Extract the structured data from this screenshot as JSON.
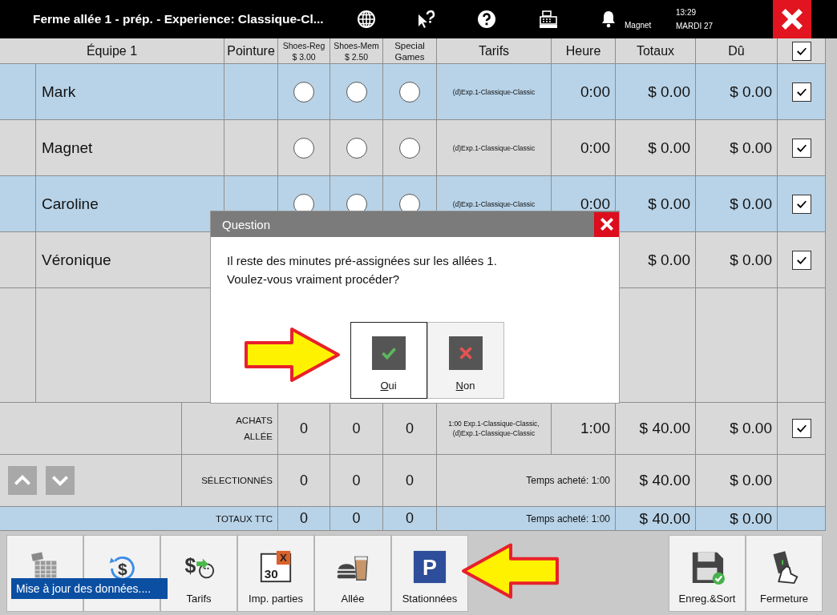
{
  "title_bar": {
    "title": "Ferme allée 1 - prép. - Experience: Classique-Cl...",
    "user": "Magnet",
    "time": "13:29",
    "date": "MARDI 27"
  },
  "table": {
    "columns": [
      {
        "label": "Équipe 1"
      },
      {
        "label": "Pointure"
      },
      {
        "label": "Shoes-Reg",
        "sub": "$ 3.00"
      },
      {
        "label": "Shoes-Mem",
        "sub": "$ 2.50"
      },
      {
        "label": "Special Games"
      },
      {
        "label": "Tarifs"
      },
      {
        "label": "Heure"
      },
      {
        "label": "Totaux"
      },
      {
        "label": "Dû"
      }
    ],
    "header_checked": true,
    "rows": [
      {
        "name": "Mark",
        "highlighted": true,
        "radios": [
          {
            "checked": false
          },
          {
            "checked": false
          },
          {
            "checked": false
          }
        ],
        "tarif": "(d)Exp.1-Classique-Classic",
        "heure": "0:00",
        "totaux": "$ 0.00",
        "du": "$ 0.00",
        "checked": true
      },
      {
        "name": "Magnet",
        "highlighted": false,
        "radios": [
          {
            "checked": false
          },
          {
            "checked": false
          },
          {
            "checked": false
          }
        ],
        "tarif": "(d)Exp.1-Classique-Classic",
        "heure": "0:00",
        "totaux": "$ 0.00",
        "du": "$ 0.00",
        "checked": true
      },
      {
        "name": "Caroline",
        "highlighted": true,
        "radios": [
          {
            "checked": false
          },
          {
            "checked": false
          },
          {
            "checked": false
          }
        ],
        "tarif": "(d)Exp.1-Classique-Classic",
        "heure": "0:00",
        "totaux": "$ 0.00",
        "du": "$ 0.00",
        "checked": true
      },
      {
        "name": "Véronique",
        "highlighted": false,
        "totaux": "$ 0.00",
        "du": "$ 0.00",
        "checked": true
      }
    ],
    "summary": [
      {
        "kind": "purchases",
        "label": "ACHATS ALLÉE",
        "counts": [
          "0",
          "0",
          "0"
        ],
        "tarif": "1:00 Exp.1-Classique-Classic, (d)Exp.1-Classique-Classic",
        "heure": "1:00",
        "totaux": "$ 40.00",
        "du": "$ 0.00",
        "checked": true
      },
      {
        "kind": "selected",
        "label": "SÉLECTIONNÉS",
        "counts": [
          "0",
          "0",
          "0"
        ],
        "time": "Temps acheté: 1:00",
        "totaux": "$ 40.00",
        "du": "$ 0.00"
      },
      {
        "kind": "total",
        "label": "TOTAUX TTC",
        "counts": [
          "0",
          "0",
          "0"
        ],
        "time": "Temps acheté: 1:00",
        "totaux": "$ 40.00",
        "du": "$ 0.00"
      }
    ]
  },
  "dialog": {
    "title": "Question",
    "message": "Il reste des minutes pré-assignées sur les allées  1.\nVoulez-vous vraiment procéder?",
    "buttons": [
      {
        "label": "Oui",
        "kind": "yes",
        "selected": true
      },
      {
        "label": "Non",
        "kind": "no",
        "selected": false
      }
    ]
  },
  "toolbar": {
    "left": [
      {
        "kind": "cards"
      },
      {
        "kind": "refund",
        "icon_text": "$"
      },
      {
        "kind": "tariffs",
        "label": "Tarifs",
        "icon_text": "$"
      },
      {
        "kind": "print",
        "label": "Imp. parties",
        "icon_text": "30",
        "icon_badge": "X"
      },
      {
        "kind": "food",
        "label": "Allée"
      },
      {
        "kind": "parking",
        "label": "Stationnées",
        "icon_text": "P"
      }
    ],
    "right": [
      {
        "kind": "save",
        "label": "Enreg.&Sort"
      },
      {
        "kind": "close",
        "label": "Fermeture"
      }
    ],
    "status": "Mise à jour des données...."
  }
}
